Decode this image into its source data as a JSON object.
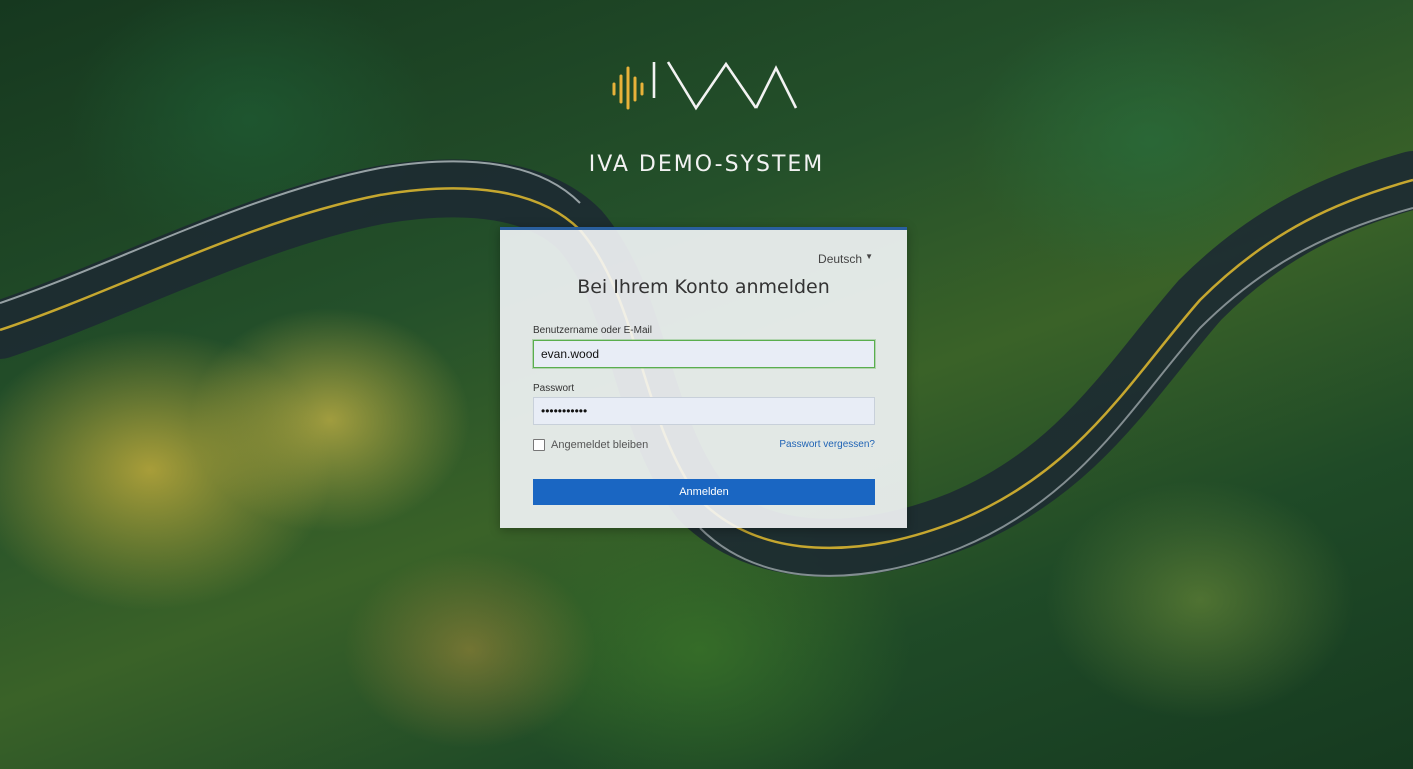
{
  "brand": {
    "title": "IVA DEMO-SYSTEM",
    "logo_icon": "iva-waveform-logo",
    "logo_accent": "#e8b23a",
    "logo_line": "#f2f2f2"
  },
  "login": {
    "language": "Deutsch",
    "title": "Bei Ihrem Konto anmelden",
    "username_label": "Benutzername oder E-Mail",
    "username_value": "evan.wood",
    "password_label": "Passwort",
    "password_value": "•••••••••••",
    "remember_label": "Angemeldet bleiben",
    "forgot_link": "Passwort vergessen?",
    "submit_label": "Anmelden"
  },
  "colors": {
    "primary": "#1a66c2",
    "link": "#2164b5",
    "focus_border": "#5aae4e",
    "card_top_border": "#2a5f9e"
  }
}
